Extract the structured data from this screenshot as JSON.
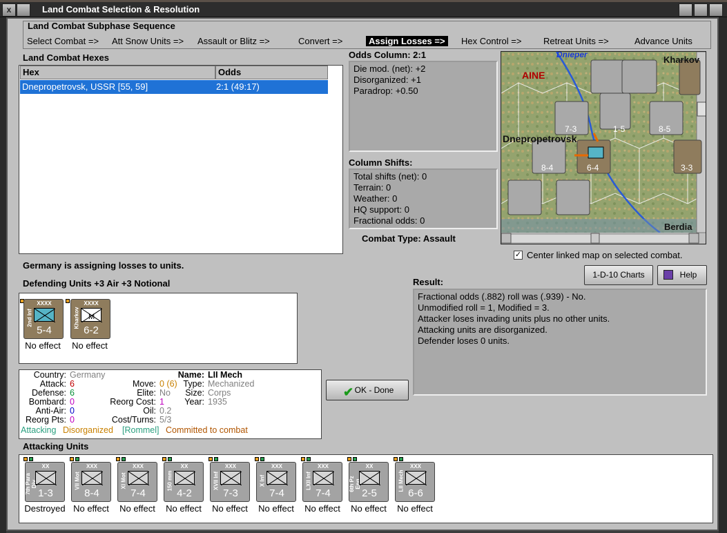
{
  "window": {
    "title": "Land Combat Selection & Resolution",
    "close_label": "x"
  },
  "sequence": {
    "title": "Land Combat Subphase Sequence",
    "steps": [
      "Select Combat =>",
      "Att Snow Units =>",
      "Assault or Blitz =>",
      "Convert =>",
      "Assign Losses =>",
      "Hex Control =>",
      "Retreat Units =>",
      "Advance Units"
    ],
    "active": "Assign Losses =>"
  },
  "hexes": {
    "title": "Land Combat Hexes",
    "col_hex": "Hex",
    "col_odds": "Odds",
    "rows": [
      {
        "hex": "Dnepropetrovsk, USSR [55, 59]",
        "odds": "2:1 (49:17)"
      }
    ]
  },
  "odds_column": {
    "title": "Odds Column: 2:1",
    "lines": [
      "Die mod. (net): +2",
      "Disorganized: +1",
      "Paradrop: +0.50"
    ]
  },
  "column_shifts": {
    "title": "Column Shifts:",
    "lines": [
      "Total shifts (net): 0",
      "Terrain: 0",
      "Weather: 0",
      "HQ support: 0",
      "Fractional odds: 0"
    ]
  },
  "combat_type": "Combat Type:  Assault",
  "center_map": {
    "label": "Center linked map on selected combat.",
    "checked": true,
    "mark": "✓"
  },
  "map": {
    "labels": [
      "Dnieper",
      "Kharkov",
      "AINE",
      "Dnepropetrovsk",
      "Berdia"
    ]
  },
  "status_text": "Germany is assigning losses to units.",
  "buttons": {
    "charts": "1-D-10 Charts",
    "help": "Help",
    "ok": "OK - Done"
  },
  "result": {
    "title": "Result:",
    "lines": [
      "Fractional odds (.882) roll was (.939)  - No.",
      "Unmodified roll = 1, Modified = 3.",
      "Attacker loses invading units plus no other units.",
      "Attacking units are disorganized.",
      "Defender loses 0 units."
    ]
  },
  "defending": {
    "title": "Defending Units +3 Air +3 Notional",
    "units": [
      {
        "size": "XXXX",
        "name": "2nd Inf",
        "strength": "5-4",
        "status": "No effect",
        "color": "brown"
      },
      {
        "size": "XXXX",
        "name": "Kharkov",
        "strength": "6-2",
        "status": "No effect",
        "color": "brown"
      }
    ]
  },
  "unit_detail": {
    "country_label": "Country:",
    "country": "Germany",
    "attack_label": "Attack:",
    "attack": "6",
    "defense_label": "Defense:",
    "defense": "6",
    "bombard_label": "Bombard:",
    "bombard": "0",
    "antiair_label": "Anti-Air:",
    "antiair": "0",
    "reorg_label": "Reorg Pts:",
    "reorg": "0",
    "move_label": "Move:",
    "move": "0 (6)",
    "elite_label": "Elite:",
    "elite": "No",
    "reorgcost_label": "Reorg Cost:",
    "reorgcost": "1",
    "oil_label": "Oil:",
    "oil": "0.2",
    "costturns_label": "Cost/Turns:",
    "costturns": "5/3",
    "name_label": "Name:",
    "name": "LII Mech",
    "type_label": "Type:",
    "type": "Mechanized",
    "size_label": "Size:",
    "size": "Corps",
    "year_label": "Year:",
    "year": "1935",
    "flags": {
      "attacking": "Attacking",
      "disorganized": "Disorganized",
      "rommel": "[Rommel]",
      "committed": "Committed to combat"
    }
  },
  "attacking": {
    "title": "Attacking Units",
    "units": [
      {
        "size": "XX",
        "name": "7th Para Div",
        "strength": "1-3",
        "status": "Destroyed"
      },
      {
        "size": "XXX",
        "name": "VII Mot",
        "strength": "8-4",
        "status": "No effect"
      },
      {
        "size": "XXX",
        "name": "XI Mot",
        "strength": "7-4",
        "status": "No effect"
      },
      {
        "size": "XX",
        "name": "150 mm",
        "strength": "4-2",
        "status": "No effect"
      },
      {
        "size": "XXX",
        "name": "XVII Inf",
        "strength": "7-3",
        "status": "No effect"
      },
      {
        "size": "XXX",
        "name": "X Inf",
        "strength": "7-4",
        "status": "No effect"
      },
      {
        "size": "XXX",
        "name": "LXII Inf",
        "strength": "7-4",
        "status": "No effect"
      },
      {
        "size": "XX",
        "name": "6th Pz Eng",
        "strength": "2-5",
        "status": "No effect"
      },
      {
        "size": "XXX",
        "name": "LII Mech",
        "strength": "6-6",
        "status": "No effect"
      }
    ]
  },
  "colors": {
    "selection": "#1f72d6",
    "panel": "#c0c0c0",
    "info_bg": "#a9a9a9",
    "unit_brown": "#8f7c5d",
    "unit_grey": "#a3a3a3"
  }
}
